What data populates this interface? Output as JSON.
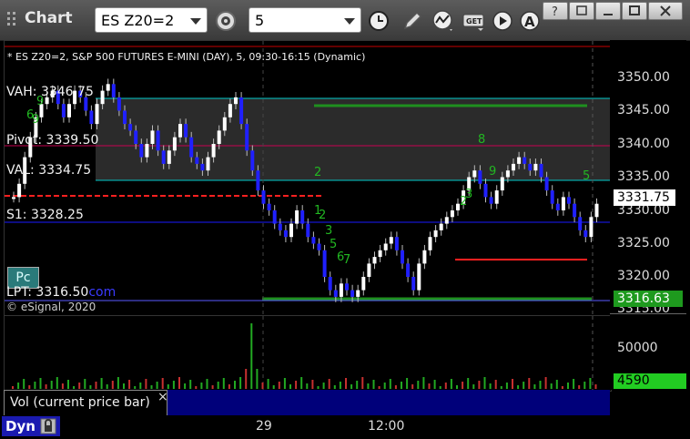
{
  "app": {
    "title": "Chart"
  },
  "toolbar": {
    "symbol": "ES Z20=2",
    "interval": "5"
  },
  "chart_header": "* ES Z20=2, S&P 500 FUTURES E-MINI (DAY), 5, 09:30-16:15 (Dynamic)",
  "levels": {
    "vah": "VAH: 3346.75",
    "pivot": "Pivot: 3339.50",
    "val": "VAL: 3334.75",
    "s1": "S1: 3328.25",
    "lpt": "LPT: 3316.50"
  },
  "watermark_suffix": "com",
  "pc_badge": "Pc",
  "copyright": "© eSignal, 2020",
  "price_axis": {
    "labels": [
      "3350.00",
      "3345.00",
      "3340.00",
      "3335.00",
      "3330.00",
      "3325.00",
      "3320.00",
      "3315.00"
    ],
    "last_price": "3331.75",
    "lpt_tag": "3316.63"
  },
  "volume_axis": {
    "label": "50000",
    "current": "4590"
  },
  "vol_panel": {
    "label": "Vol (current price bar)",
    "close": "×"
  },
  "time_axis": {
    "labels": [
      "29",
      "12:00"
    ]
  },
  "status": {
    "dyn": "Dyn"
  },
  "colors": {
    "vah": "#00c8c8",
    "pivot": "#c80050",
    "s1": "#1a1aff",
    "green_line": "#1f8f1f",
    "red_line": "#ff2020",
    "volume_tag": "#22cc22",
    "price_tag": "#ffffff"
  },
  "annotations": [
    "9",
    "6",
    "9",
    "2",
    "1",
    "2",
    "3",
    "5",
    "6",
    "7",
    "8",
    "9",
    "2",
    "3",
    "5"
  ]
}
